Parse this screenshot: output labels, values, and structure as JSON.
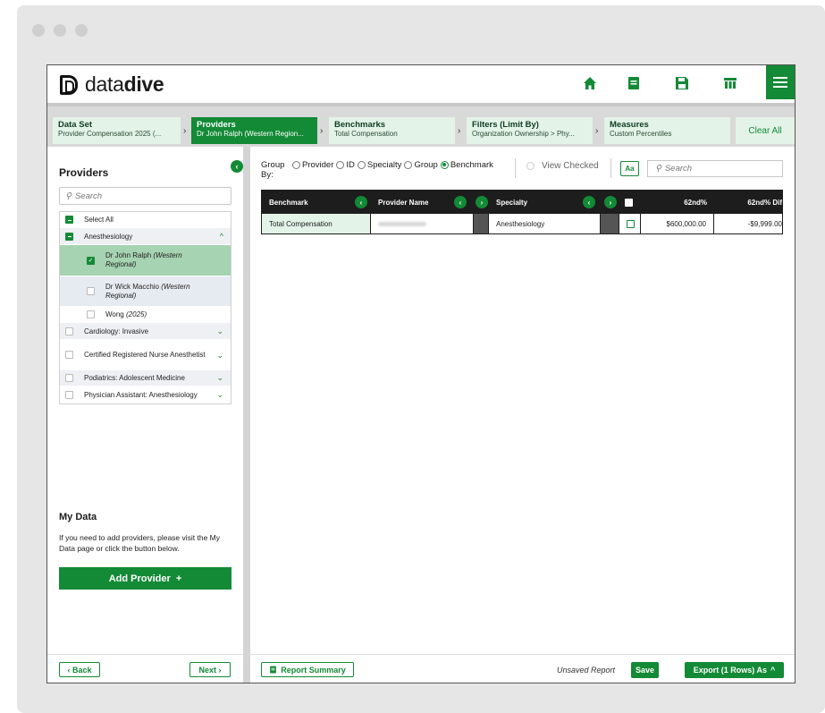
{
  "app": {
    "logo_light": "data",
    "logo_bold": "dive",
    "accent": "#138a36"
  },
  "topbar": {
    "icons": [
      "home-icon",
      "document-icon",
      "save-icon",
      "table-icon",
      "menu-icon"
    ]
  },
  "breadcrumbs": [
    {
      "title": "Data Set",
      "subtitle": "Provider Compensation 2025 (..."
    },
    {
      "title": "Providers",
      "subtitle": "Dr John Ralph (Western Region..."
    },
    {
      "title": "Benchmarks",
      "subtitle": "Total Compensation"
    },
    {
      "title": "Filters (Limit By)",
      "subtitle": "Organization Ownership > Phy..."
    },
    {
      "title": "Measures",
      "subtitle": "Custom Percentiles"
    }
  ],
  "clear_all": "Clear All",
  "sidebar": {
    "title": "Providers",
    "search_placeholder": "Search",
    "items": [
      {
        "label": "Select All"
      },
      {
        "label": "Anesthesiology"
      },
      {
        "label": "Dr John Ralph",
        "extra": "(Western Regional)"
      },
      {
        "label": "Dr Wick Macchio",
        "extra": "(Western Regional)"
      },
      {
        "label": "Wong",
        "extra": "(2025)"
      },
      {
        "label": "Cardiology: Invasive"
      },
      {
        "label": "Certified Registered Nurse Anesthetist"
      },
      {
        "label": "Podiatrics: Adolescent Medicine"
      },
      {
        "label": "Physician Assistant: Anesthesiology"
      }
    ],
    "my_data_title": "My Data",
    "my_data_text": "If you need to add providers, please visit the My Data page or click the button below.",
    "add_provider": "Add Provider",
    "back": "Back",
    "next": "Next"
  },
  "main": {
    "group_label": "Group By:",
    "options": [
      "Provider",
      "ID",
      "Specialty",
      "Group",
      "Benchmark"
    ],
    "selected_option": "Benchmark",
    "view_checked": "View Checked",
    "aa": "Aa",
    "search_placeholder": "Search",
    "columns": [
      "Benchmark",
      "Provider Name",
      "Specialty",
      "62nd%",
      "62nd% Dif"
    ],
    "row": {
      "benchmark": "Total Compensation",
      "specialty": "Anesthesiology",
      "value_62": "$600,000.00",
      "dif_62": "-$9,999.00"
    },
    "report_summary": "Report Summary",
    "unsaved": "Unsaved Report",
    "save": "Save",
    "export": "Export (1 Rows) As"
  }
}
